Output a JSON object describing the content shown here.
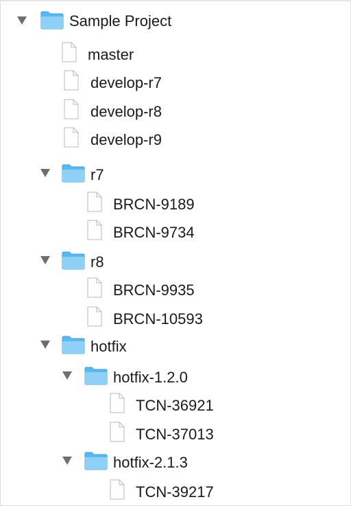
{
  "tree": {
    "root": {
      "label": "Sample Project",
      "expanded": true
    },
    "files": [
      {
        "label": "master"
      },
      {
        "label": "develop-r7"
      },
      {
        "label": "develop-r8"
      },
      {
        "label": "develop-r9"
      }
    ],
    "r7": {
      "label": "r7",
      "expanded": true,
      "files": [
        {
          "label": "BRCN-9189"
        },
        {
          "label": "BRCN-9734"
        }
      ]
    },
    "r8": {
      "label": "r8",
      "expanded": true,
      "files": [
        {
          "label": "BRCN-9935"
        },
        {
          "label": "BRCN-10593"
        }
      ]
    },
    "hotfix": {
      "label": "hotfix",
      "expanded": true,
      "h120": {
        "label": "hotfix-1.2.0",
        "expanded": true,
        "files": [
          {
            "label": "TCN-36921"
          },
          {
            "label": "TCN-37013"
          }
        ]
      },
      "h213": {
        "label": "hotfix-2.1.3",
        "expanded": true,
        "files": [
          {
            "label": "TCN-39217"
          }
        ]
      }
    }
  },
  "colors": {
    "folder": "#5ab8f0",
    "folder_light": "#8fd0f7",
    "disclosure": "#6e6e6e",
    "text": "#1a1a1a"
  }
}
